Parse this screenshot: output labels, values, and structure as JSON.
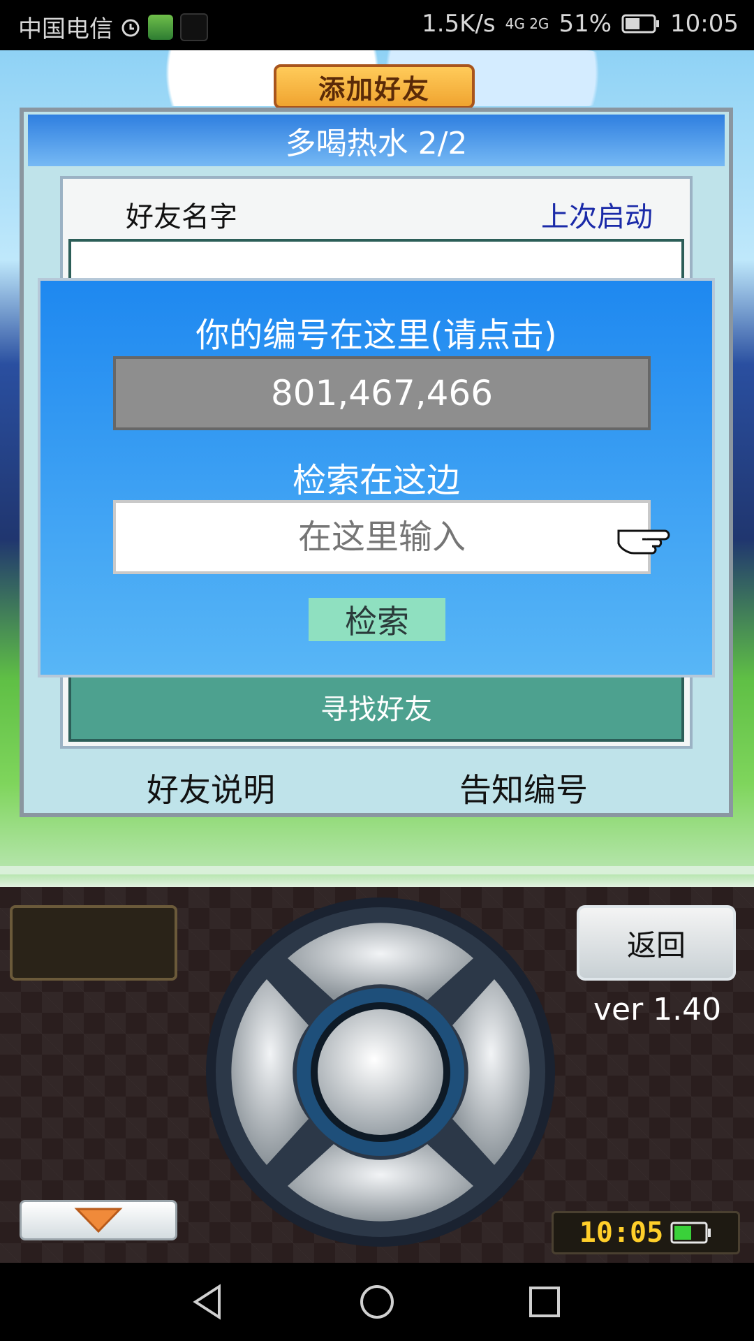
{
  "status_bar": {
    "carrier": "中国电信",
    "net_speed": "1.5K/s",
    "network": "4G 2G",
    "battery": "51%",
    "time": "10:05"
  },
  "game": {
    "title_tab": "添加好友",
    "panel_title": "多喝热水 2/2",
    "col_friend_name": "好友名字",
    "col_last_launch": "上次启动",
    "find_friends": "寻找好友",
    "friend_help": "好友说明",
    "share_id": "告知编号"
  },
  "popup": {
    "title": "你的编号在这里(请点击)",
    "player_id": "801,467,466",
    "search_label": "检索在这边",
    "search_placeholder": "在这里输入",
    "search_button": "检索"
  },
  "controls": {
    "back": "返回",
    "version": "ver 1.40",
    "clock": "10:05"
  },
  "colors": {
    "popup_blue": "#1e88f0",
    "header_blue": "#2f7fe0",
    "find_green": "#4da18f",
    "clock_yellow": "#ffcf2a"
  }
}
